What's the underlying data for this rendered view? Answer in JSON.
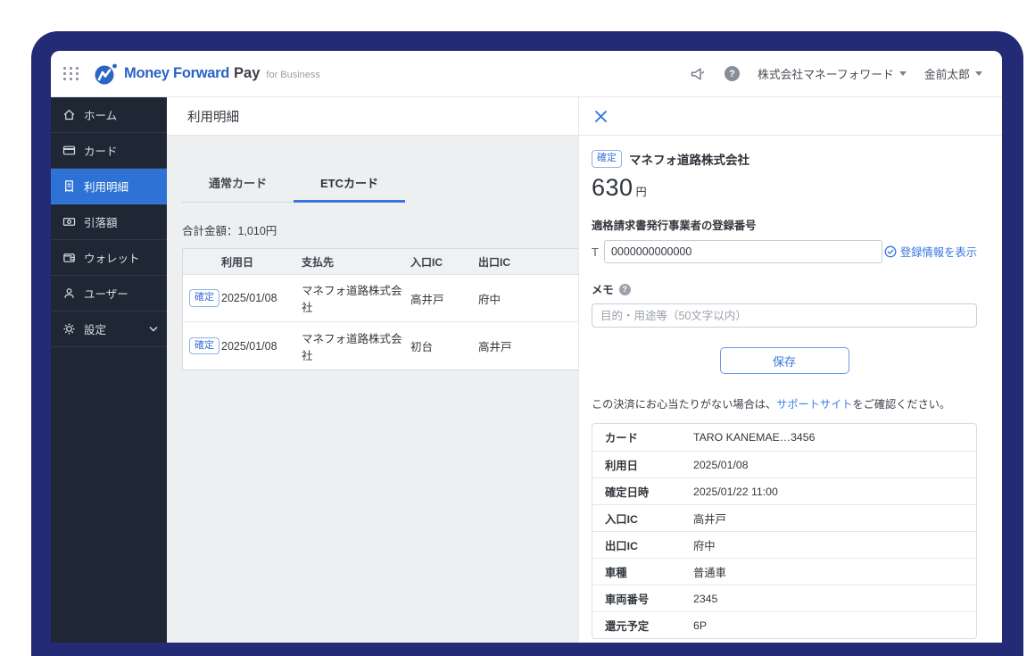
{
  "colors": {
    "accent": "#3576df",
    "frame_navy": "#232b77",
    "sidebar_bg": "#202734",
    "sidebar_selected": "#2d72d4",
    "main_bg": "#edeff1",
    "badge_blue": "#3a72d8",
    "link_blue": "#3b82e8"
  },
  "header": {
    "brand": "Money Forward",
    "product": "Pay",
    "suffix": "for Business",
    "company_menu": "株式会社マネーフォワード",
    "user_menu": "金前太郎",
    "help_glyph": "?"
  },
  "sidebar": {
    "items": [
      {
        "label": "ホーム",
        "icon": "home",
        "selected": false
      },
      {
        "label": "カード",
        "icon": "card",
        "selected": false
      },
      {
        "label": "利用明細",
        "icon": "receipt",
        "selected": true
      },
      {
        "label": "引落額",
        "icon": "banknote",
        "selected": false
      },
      {
        "label": "ウォレット",
        "icon": "wallet",
        "selected": false
      },
      {
        "label": "ユーザー",
        "icon": "user",
        "selected": false
      },
      {
        "label": "設定",
        "icon": "gear",
        "selected": false,
        "has_chevron": true
      }
    ]
  },
  "main": {
    "title": "利用明細",
    "tabs": [
      {
        "label": "通常カード",
        "active": false
      },
      {
        "label": "ETCカード",
        "active": true
      }
    ],
    "total_label": "合計金額：1,010円",
    "table": {
      "columns": [
        "",
        "利用日",
        "支払先",
        "入口IC",
        "出口IC"
      ],
      "rows": [
        {
          "status": "確定",
          "date": "2025/01/08",
          "payee": "マネフォ道路株式会社",
          "entry_ic": "高井戸",
          "exit_ic": "府中"
        },
        {
          "status": "確定",
          "date": "2025/01/08",
          "payee": "マネフォ道路株式会社",
          "entry_ic": "初台",
          "exit_ic": "高井戸"
        }
      ]
    }
  },
  "panel": {
    "status_badge": "確定",
    "merchant": "マネフォ道路株式会社",
    "amount": "630",
    "amount_unit": "円",
    "invoice_label": "適格請求書発行事業者の登録番号",
    "invoice_prefix": "T",
    "invoice_number": "0000000000000",
    "show_registration_link": "登録情報を表示",
    "memo_label": "メモ",
    "memo_help_glyph": "?",
    "memo_placeholder": "目的・用途等（50文字以内）",
    "save_button": "保存",
    "support_text_before": "この決済にお心当たりがない場合は、",
    "support_link": "サポートサイト",
    "support_text_after": "をご確認ください。",
    "details": [
      {
        "label": "カード",
        "value": "TARO KANEMAE…3456"
      },
      {
        "label": "利用日",
        "value": "2025/01/08"
      },
      {
        "label": "確定日時",
        "value": "2025/01/22 11:00"
      },
      {
        "label": "入口IC",
        "value": "高井戸"
      },
      {
        "label": "出口IC",
        "value": "府中"
      },
      {
        "label": "車種",
        "value": "普通車"
      },
      {
        "label": "車両番号",
        "value": "2345"
      },
      {
        "label": "還元予定",
        "value": "6P"
      }
    ]
  }
}
